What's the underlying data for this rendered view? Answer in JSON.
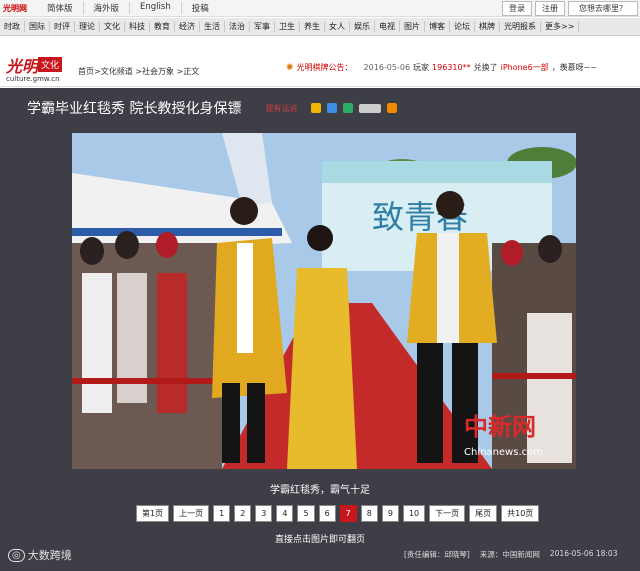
{
  "topbar": {
    "logo": "光明网",
    "langs": [
      "简体版",
      "海外版",
      "English",
      "投稿"
    ],
    "login": "登录",
    "register": "注册",
    "where": "您想去哪里？"
  },
  "nav": [
    "时政",
    "国际",
    "时评",
    "理论",
    "文化",
    "科技",
    "教育",
    "经济",
    "生活",
    "法治",
    "军事",
    "卫生",
    "养生",
    "女人",
    "娱乐",
    "电视",
    "图片",
    "博客",
    "论坛",
    "棋牌",
    "光明报系",
    "更多>>"
  ],
  "header": {
    "brand_logo": "光明",
    "channel": "文化",
    "domain": "culture.gmw.cn",
    "breadcrumb": "首页>文化频道 >社会万象 >正文",
    "notice_label": "光明棋牌公告：",
    "notice_date": "2016-05-06",
    "notice_text_1": "玩家",
    "notice_player": "196310**",
    "notice_text_2": "兑换了",
    "notice_prize": "iPhone6一部",
    "notice_text_3": "，羡慕呀~~"
  },
  "article": {
    "title": "学霸毕业红毯秀 院长教授化身保镖",
    "comment_link": "我有话说",
    "photo_banner_text": "致青春",
    "watermark_cn": "中新网",
    "watermark_url": "Chinanews.com",
    "caption": "学霸红毯秀，霸气十足",
    "hint": "直接点击图片即可翻页"
  },
  "pager": {
    "first": "第1页",
    "prev": "上一页",
    "pages": [
      "1",
      "2",
      "3",
      "4",
      "5",
      "6",
      "7",
      "8",
      "9",
      "10"
    ],
    "current": "7",
    "next": "下一页",
    "last": "尾页",
    "total": "共10页"
  },
  "footer": {
    "logo": "大数跨境",
    "editor_label": "[责任编辑：",
    "editor": "邱晓琴]",
    "source_label": "来源：",
    "source": "中国新闻网",
    "datetime": "2016-05-06 18:03"
  },
  "colors": {
    "brand_red": "#c8161d",
    "body_dark": "#3d3e46"
  }
}
